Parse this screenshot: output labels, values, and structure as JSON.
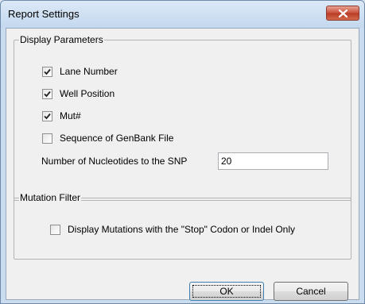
{
  "window": {
    "title": "Report Settings"
  },
  "display_parameters": {
    "legend": "Display Parameters",
    "options": [
      {
        "label": "Lane Number",
        "checked": true
      },
      {
        "label": "Well Position",
        "checked": true
      },
      {
        "label": "Mut#",
        "checked": true
      },
      {
        "label": "Sequence of GenBank File",
        "checked": false
      }
    ],
    "nucleotides_label": "Number of Nucleotides to the SNP",
    "nucleotides_value": "20"
  },
  "mutation_filter": {
    "legend": "Mutation Filter",
    "stop_codon_label": "Display Mutations with the \"Stop\" Codon or Indel Only",
    "stop_codon_checked": false
  },
  "buttons": {
    "ok": "OK",
    "cancel": "Cancel"
  },
  "icons": {
    "close": "close-icon",
    "check": "check-mark-icon"
  },
  "colors": {
    "title_bar": "#c9dcf0",
    "close_button": "#c9503a",
    "dialog_bg": "#f0f0f0"
  }
}
